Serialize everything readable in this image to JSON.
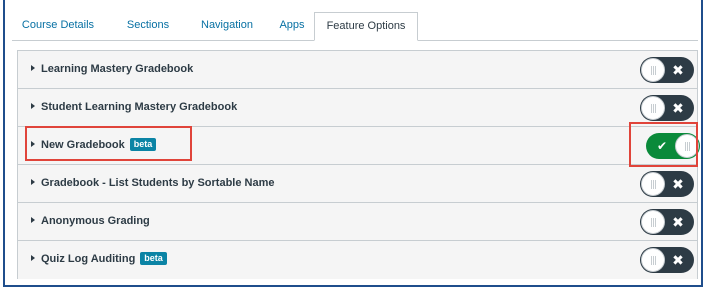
{
  "tabs": [
    {
      "label": "Course Details"
    },
    {
      "label": "Sections"
    },
    {
      "label": "Navigation"
    },
    {
      "label": "Apps"
    },
    {
      "label": "Feature Options"
    }
  ],
  "features": [
    {
      "name": "Learning Mastery Gradebook",
      "badge": "",
      "enabled": false
    },
    {
      "name": "Student Learning Mastery Gradebook",
      "badge": "",
      "enabled": false
    },
    {
      "name": "New Gradebook",
      "badge": "beta",
      "enabled": true
    },
    {
      "name": "Gradebook - List Students by Sortable Name",
      "badge": "",
      "enabled": false
    },
    {
      "name": "Anonymous Grading",
      "badge": "",
      "enabled": false
    },
    {
      "name": "Quiz Log Auditing",
      "badge": "beta",
      "enabled": false
    }
  ],
  "toggle_marks": {
    "off": "✖",
    "on": "✔"
  },
  "colors": {
    "toggle_on": "#0a8a3a",
    "toggle_off": "#2d3b45",
    "highlight": "#e0443a",
    "badge": "#0b84a5"
  }
}
